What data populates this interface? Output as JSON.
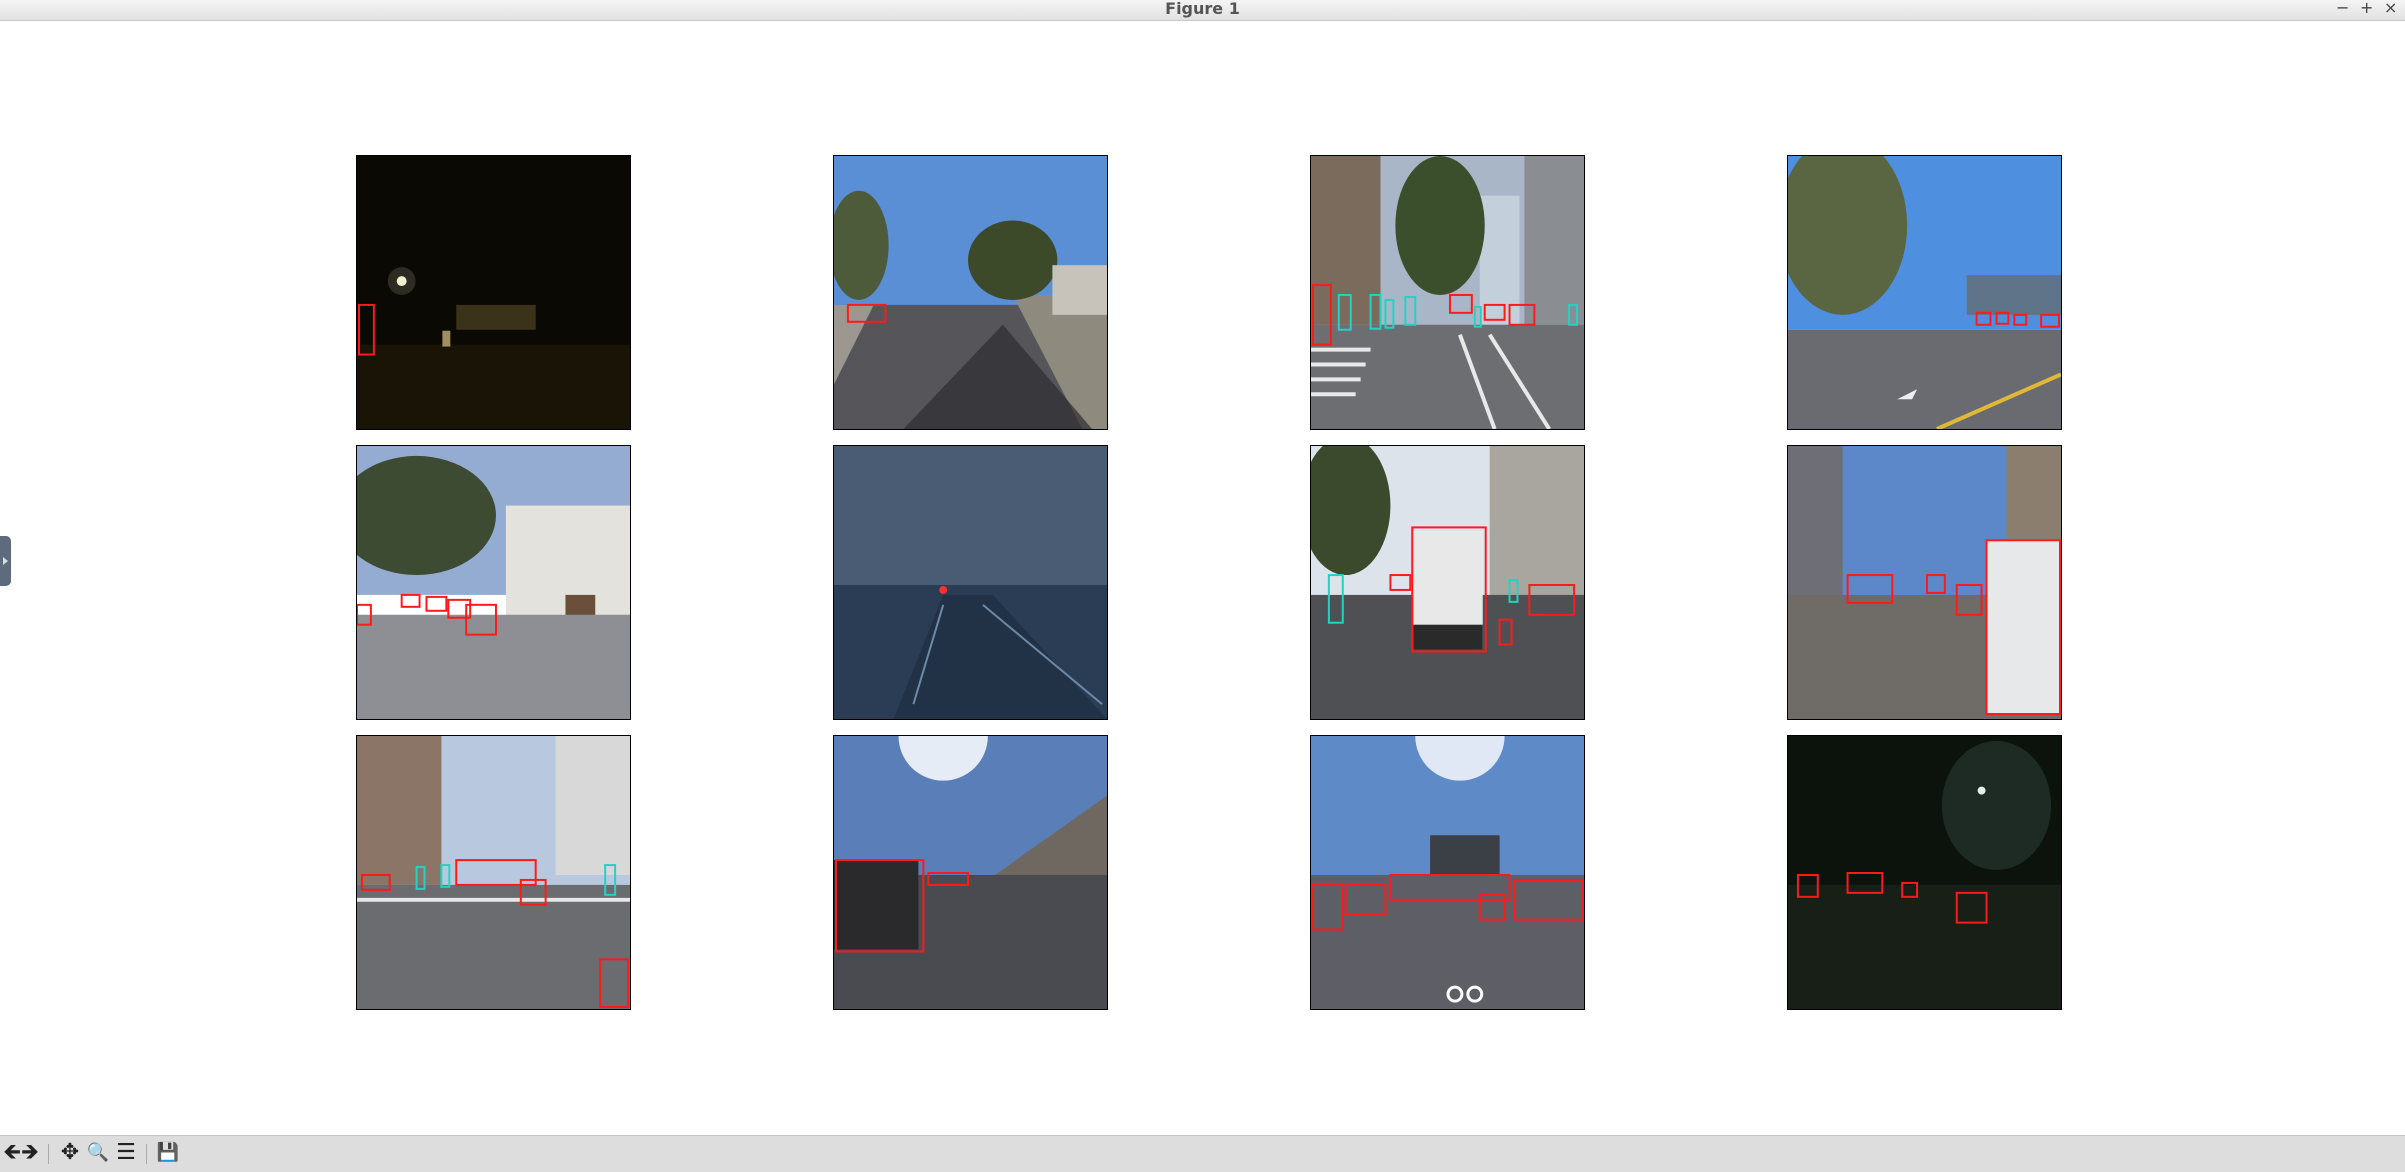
{
  "window": {
    "title": "Figure 1",
    "controls": {
      "minimize": "−",
      "maximize": "+",
      "close": "×"
    }
  },
  "figure": {
    "panels": [
      {
        "id": "r1c1",
        "scene": "night street, dark, single streetlight, one vehicle box at left edge"
      },
      {
        "id": "r1c2",
        "scene": "sunny residential road with trees, one vehicle box"
      },
      {
        "id": "r1c3",
        "scene": "city intersection with crosswalk, many vehicle and pedestrian boxes"
      },
      {
        "id": "r1c4",
        "scene": "sunny wide road with palm trees, distant vehicle boxes"
      },
      {
        "id": "r2c1",
        "scene": "residential hill street, parked car boxes"
      },
      {
        "id": "r2c2",
        "scene": "foggy highway at dusk, taillights"
      },
      {
        "id": "r2c3",
        "scene": "urban street with box truck ahead, cones, pedestrian boxes"
      },
      {
        "id": "r2c4",
        "scene": "street with parked van on right, vehicle boxes"
      },
      {
        "id": "r3c1",
        "scene": "downtown intersection, many car and pedestrian boxes"
      },
      {
        "id": "r3c2",
        "scene": "freeway with bright sun, dump truck on left"
      },
      {
        "id": "r3c3",
        "scene": "multi-lane road with bike lane marking, many vehicle boxes"
      },
      {
        "id": "r3c4",
        "scene": "night wet street, vehicle boxes with red lights"
      }
    ],
    "colors": {
      "vehicle_box": "#ff1a1a",
      "pedestrian_box": "#22d3c5"
    }
  },
  "toolbar": {
    "icons": [
      "back-arrow-icon",
      "forward-arrow-icon",
      "pan-icon",
      "zoom-icon",
      "configure-subplots-icon",
      "save-icon"
    ],
    "glyphs": {
      "back": "🡸",
      "forward": "🡺",
      "pan": "✥",
      "zoom": "🔍",
      "configure": "☰",
      "save": "💾"
    }
  }
}
